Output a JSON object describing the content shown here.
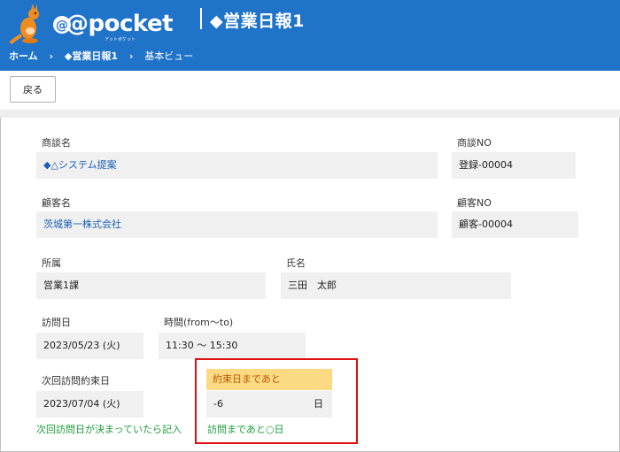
{
  "header": {
    "logo_text": "@pocket",
    "logo_subtext": "アットポケット",
    "app_title": "◆営業日報1",
    "colors": {
      "bar": "#1f73c8",
      "logo_orange": "#f08c1e"
    }
  },
  "breadcrumb": {
    "home": "ホーム",
    "sep1": "›",
    "app": "◆営業日報1",
    "sep2": "›",
    "view": "基本ビュー"
  },
  "toolbar": {
    "back_label": "戻る"
  },
  "form": {
    "deal_name": {
      "label": "商談名",
      "value": "◆△システム提案"
    },
    "deal_no": {
      "label": "商談NO",
      "value": "登録-00004"
    },
    "customer_name": {
      "label": "顧客名",
      "value": "茨城第一株式会社"
    },
    "customer_no": {
      "label": "顧客NO",
      "value": "顧客-00004"
    },
    "department": {
      "label": "所属",
      "value": "営業1課"
    },
    "person_name": {
      "label": "氏名",
      "value": "三田　太郎"
    },
    "visit_date": {
      "label": "訪問日",
      "value": "2023/05/23 (火)"
    },
    "visit_time": {
      "label": "時間(from～to)",
      "value": "11:30 ～ 15:30"
    },
    "next_visit_date": {
      "label": "次回訪問約束日",
      "value": "2023/07/04 (火)",
      "hint": "次回訪問日が決まっていたら記入"
    },
    "days_until": {
      "label": "約束日まであと",
      "value": "-6",
      "unit": "日",
      "hint": "訪問まであと○日"
    }
  }
}
